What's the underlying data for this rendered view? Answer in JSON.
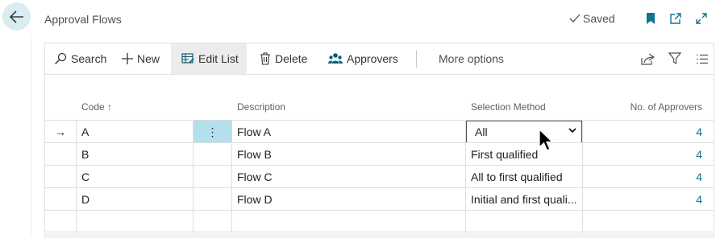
{
  "header": {
    "title": "Approval Flows",
    "saved_label": "Saved"
  },
  "toolbar": {
    "search_label": "Search",
    "new_label": "New",
    "edit_list_label": "Edit List",
    "delete_label": "Delete",
    "approvers_label": "Approvers",
    "more_options_label": "More options"
  },
  "table": {
    "columns": {
      "code": "Code",
      "code_sort": "↑",
      "description": "Description",
      "selection_method": "Selection Method",
      "no_of_approvers": "No. of Approvers"
    },
    "rows": [
      {
        "code": "A",
        "description": "Flow A",
        "selection_method": "All",
        "approvers": "4"
      },
      {
        "code": "B",
        "description": "Flow B",
        "selection_method": "First qualified",
        "approvers": "4"
      },
      {
        "code": "C",
        "description": "Flow C",
        "selection_method": "All to first qualified",
        "approvers": "4"
      },
      {
        "code": "D",
        "description": "Flow D",
        "selection_method": "Initial and first quali...",
        "approvers": "4"
      }
    ],
    "selected_row_marker": "→",
    "row_menu_glyph": "⋮"
  },
  "colors": {
    "accent": "#0f7493",
    "back_button_bg": "#d9ecf1",
    "focused_cell": "#b3e0ec"
  },
  "icons": [
    "back-arrow-icon",
    "checkmark-icon",
    "bookmark-icon",
    "open-new-window-icon",
    "expand-icon",
    "search-icon",
    "plus-icon",
    "edit-list-icon",
    "trash-icon",
    "approvers-icon",
    "share-icon",
    "filter-icon",
    "list-view-icon",
    "chevron-down-icon",
    "mouse-cursor-icon"
  ]
}
